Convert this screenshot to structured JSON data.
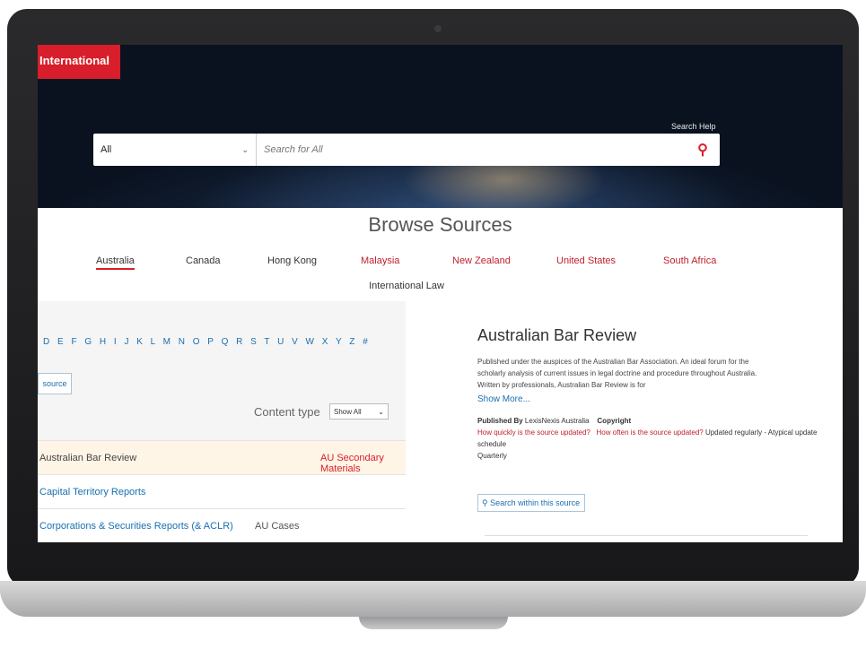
{
  "brand": "International",
  "hero": {
    "search_help": "Search Help",
    "scope_value": "All",
    "search_placeholder": "Search for All"
  },
  "browse": {
    "title": "Browse Sources",
    "tabs": [
      "Australia",
      "Canada",
      "Hong Kong",
      "Malaysia",
      "New Zealand",
      "United States",
      "South Africa"
    ],
    "active_tab": "Australia",
    "international_law": "International Law"
  },
  "left": {
    "alphabet": "D E F G H I J K L M N O P Q R S T U V W X Y Z #",
    "source_button": "source",
    "content_type_label": "Content type",
    "content_type_value": "Show All",
    "rows": [
      {
        "name": "Australian Bar Review",
        "type": "AU Secondary Materials"
      },
      {
        "name": "Capital Territory Reports",
        "type": ""
      },
      {
        "name": "Corporations & Securities Reports (& ACLR)",
        "type": "AU Cases"
      }
    ]
  },
  "detail": {
    "title": "Australian Bar Review",
    "description": "Published under the auspices of the Australian Bar Association. An ideal forum for the scholarly analysis of current issues in legal doctrine and procedure throughout Australia. Written by professionals, Australian Bar Review is for",
    "show_more": "Show More...",
    "published_by_label": "Published By",
    "published_by": "LexisNexis Australia",
    "copyright_label": "Copyright",
    "how_quickly_label": "How quickly is the source updated?",
    "how_quickly": "Quarterly",
    "how_often_label": "How often is the source updated?",
    "how_often": "Updated regularly - Atypical update schedule",
    "search_within": "Search within this source"
  }
}
